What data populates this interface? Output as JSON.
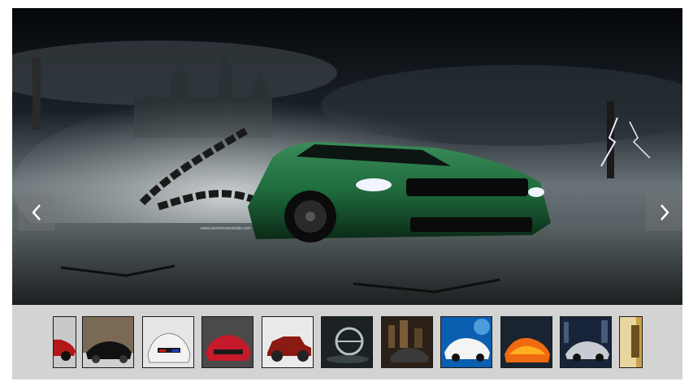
{
  "slider": {
    "main_slide": {
      "subject": "green muscle car in chains, dark castle and lightning",
      "watermark": "www.sevenhorsestudio.com"
    },
    "prev_icon": "chevron-left-icon",
    "next_icon": "chevron-right-icon",
    "colors": {
      "strip_background": "#d3d3d3",
      "car_green": "#1e6b3c",
      "sky": "#0a0d12"
    },
    "thumbnails": [
      {
        "id": "red-car",
        "bg": "#c9c9c9",
        "car": "#b31818"
      },
      {
        "id": "black-sedan",
        "bg": "#7a6a55",
        "car": "#111111"
      },
      {
        "id": "white-police-car",
        "bg": "#e6e6e6",
        "car": "#f2f2f2"
      },
      {
        "id": "red-concept-car",
        "bg": "#4a4a4a",
        "car": "#c41a2a"
      },
      {
        "id": "vintage-red-car",
        "bg": "#eaeaea",
        "car": "#8a1a12"
      },
      {
        "id": "steering-wheel-art",
        "bg": "#1c2224",
        "car": "#b8c4c0"
      },
      {
        "id": "city-night-car",
        "bg": "#2a2018",
        "car": "#3a3a3a"
      },
      {
        "id": "white-mustang-blue",
        "bg": "#0b5fb0",
        "car": "#f4f4f4"
      },
      {
        "id": "fire-car",
        "bg": "#1a2430",
        "car": "#f06a10"
      },
      {
        "id": "bmw-i8-night",
        "bg": "#18243a",
        "car": "#c8ccd2"
      },
      {
        "id": "golden-car",
        "bg": "#c9a24a",
        "car": "#e8d6a0"
      }
    ]
  }
}
